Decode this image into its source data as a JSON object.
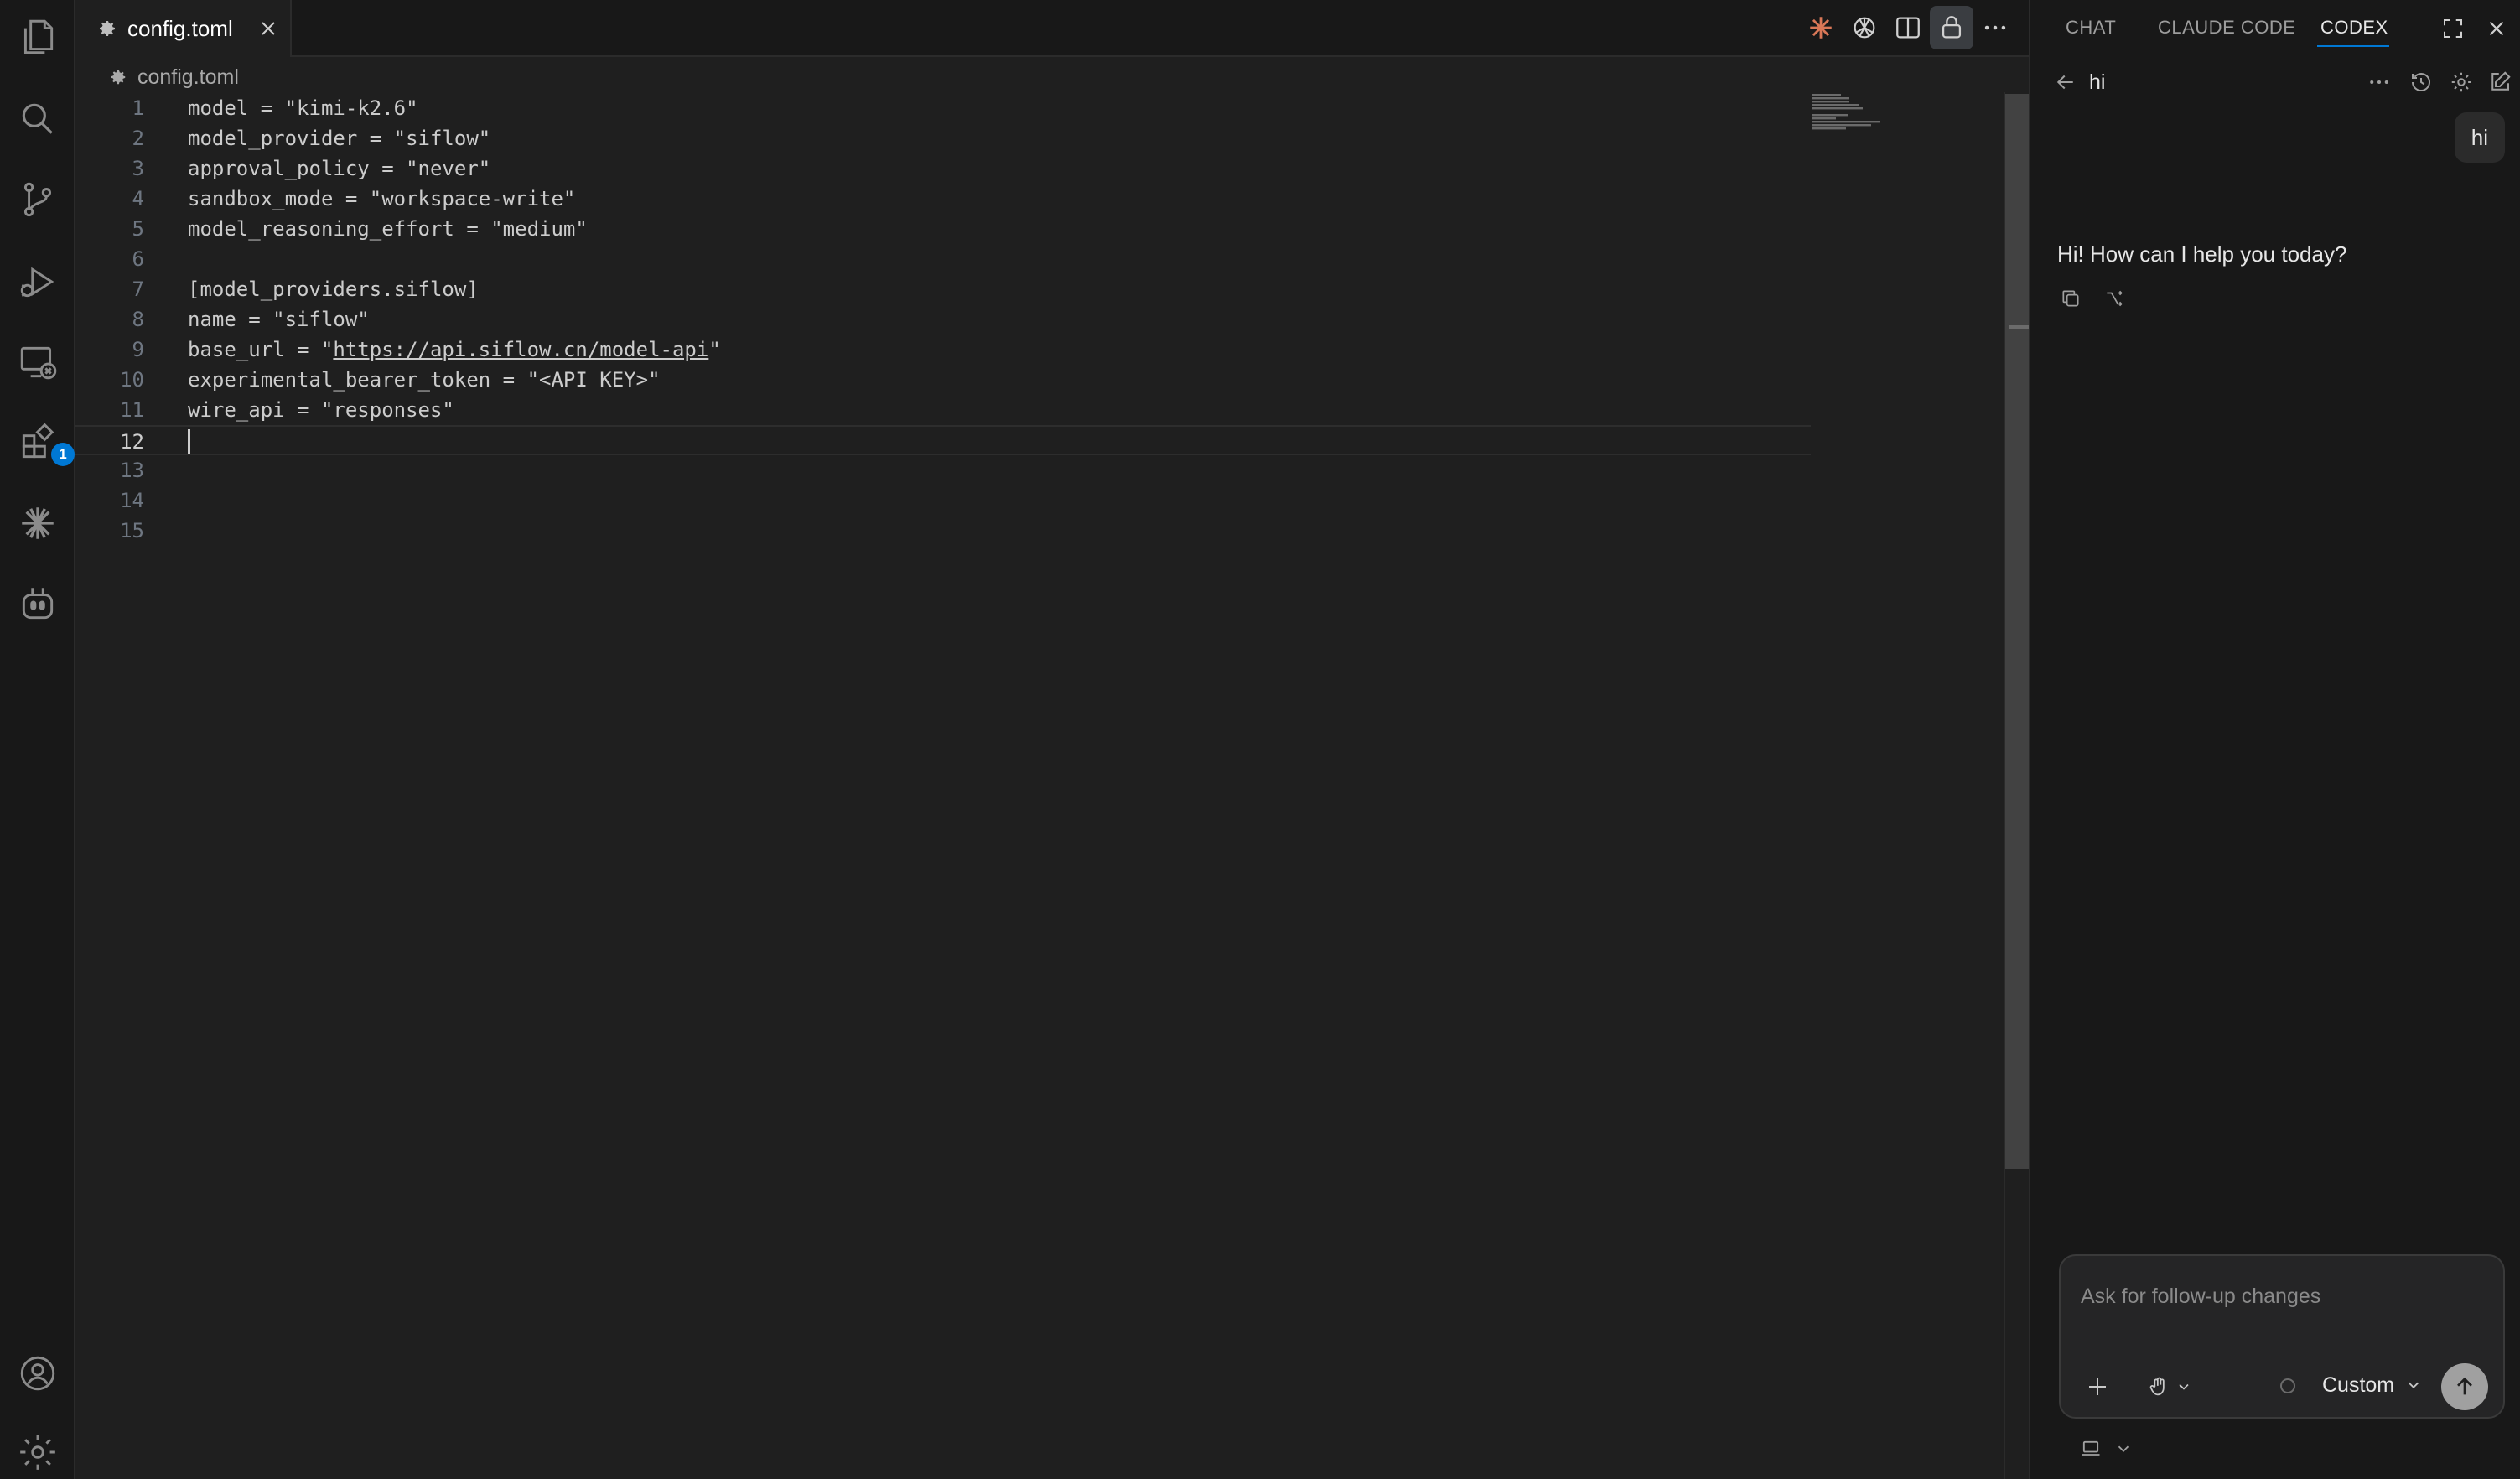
{
  "activity_bar": {
    "icons": [
      "explorer-icon",
      "search-icon",
      "source-control-icon",
      "run-debug-icon",
      "remote-explorer-icon",
      "extensions-icon",
      "claude-icon",
      "copilot-icon",
      "account-icon",
      "settings-icon"
    ],
    "extensions_badge": "1"
  },
  "editor": {
    "tab": {
      "label": "config.toml"
    },
    "breadcrumb": "config.toml",
    "active_line": 12,
    "lines": [
      {
        "n": "1",
        "text": "model = \"kimi-k2.6\""
      },
      {
        "n": "2",
        "text": "model_provider = \"siflow\""
      },
      {
        "n": "3",
        "text": "approval_policy = \"never\""
      },
      {
        "n": "4",
        "text": "sandbox_mode = \"workspace-write\""
      },
      {
        "n": "5",
        "text": "model_reasoning_effort = \"medium\""
      },
      {
        "n": "6",
        "text": ""
      },
      {
        "n": "7",
        "text": "[model_providers.siflow]"
      },
      {
        "n": "8",
        "text": "name = \"siflow\""
      },
      {
        "n": "9",
        "pre": "base_url = \"",
        "url": "https://api.siflow.cn/model-api",
        "post": "\""
      },
      {
        "n": "10",
        "text": "experimental_bearer_token = \"<API KEY>\""
      },
      {
        "n": "11",
        "text": "wire_api = \"responses\""
      },
      {
        "n": "12",
        "text": ""
      },
      {
        "n": "13",
        "text": ""
      },
      {
        "n": "14",
        "text": ""
      },
      {
        "n": "15",
        "text": ""
      }
    ]
  },
  "panel": {
    "tabs": {
      "chat": "CHAT",
      "claude_code": "CLAUDE CODE",
      "codex": "CODEX"
    },
    "active_tab": "CODEX",
    "thread_title": "hi",
    "messages": {
      "user": "hi",
      "assistant": "Hi! How can I help you today?"
    },
    "composer": {
      "placeholder": "Ask for follow-up changes",
      "mode_label": "Custom"
    }
  },
  "colors": {
    "accent": "#0078d4",
    "claude_orange": "#d97757",
    "editor_bg": "#1f1f1f",
    "sidebar_bg": "#181818"
  }
}
